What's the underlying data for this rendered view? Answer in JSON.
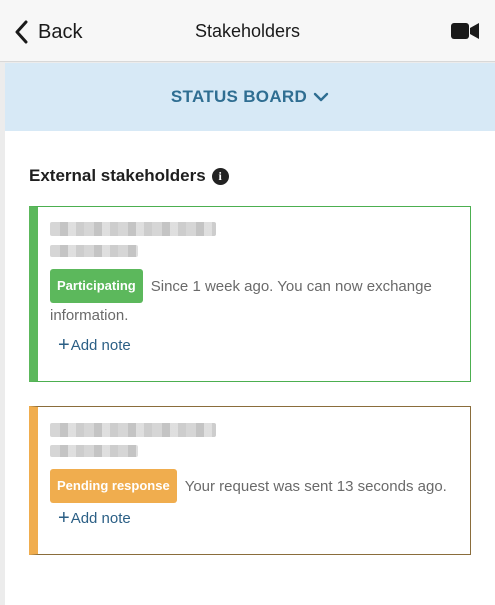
{
  "header": {
    "back_label": "Back",
    "title": "Stakeholders",
    "video_icon": "video-camera-icon"
  },
  "status_board": {
    "label": "STATUS BOARD",
    "icon": "chevron-down-icon"
  },
  "section": {
    "title": "External stakeholders",
    "info_icon": "info-icon",
    "info_glyph": "i"
  },
  "cards": [
    {
      "status": "Participating",
      "status_color": "#5cb85c",
      "description": "Since 1 week ago. You can now exchange information.",
      "add_note_plus": "+",
      "add_note_label": "Add note"
    },
    {
      "status": "Pending response",
      "status_color": "#f0ad4e",
      "description": "Your request was sent 13 seconds ago.",
      "add_note_plus": "+",
      "add_note_label": "Add note"
    }
  ],
  "colors": {
    "accent_blue": "#2f6e92",
    "status_bar_bg": "#d7e9f6",
    "link": "#2b5f85"
  }
}
